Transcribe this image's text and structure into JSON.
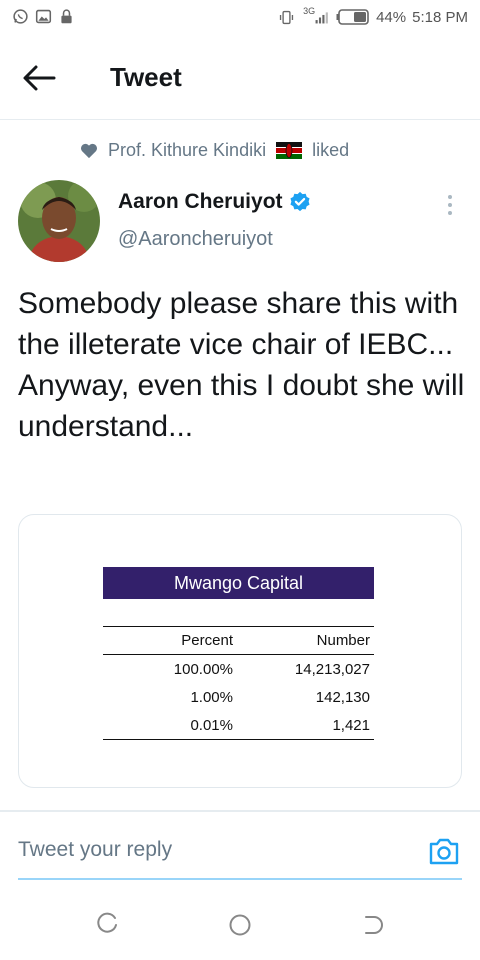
{
  "status_bar": {
    "network": "3G",
    "battery": "44%",
    "time": "5:18 PM"
  },
  "header": {
    "title": "Tweet"
  },
  "social_context": {
    "text": "Prof. Kithure Kindiki",
    "suffix": "liked"
  },
  "author": {
    "name": "Aaron Cheruiyot",
    "handle": "@Aaroncheruiyot",
    "verified": true
  },
  "tweet": {
    "text": "Somebody please share this with the illeterate vice chair of IEBC...\nAnyway, even this I doubt she will understand..."
  },
  "media": {
    "banner": "Mwango Capital",
    "table": {
      "headers": [
        "Percent",
        "Number"
      ],
      "rows": [
        [
          "100.00%",
          "14,213,027"
        ],
        [
          "1.00%",
          "142,130"
        ],
        [
          "0.01%",
          "1,421"
        ]
      ]
    }
  },
  "reply": {
    "placeholder": "Tweet your reply"
  },
  "colors": {
    "accent": "#1da1f2",
    "banner": "#33206b",
    "muted": "#657786"
  }
}
